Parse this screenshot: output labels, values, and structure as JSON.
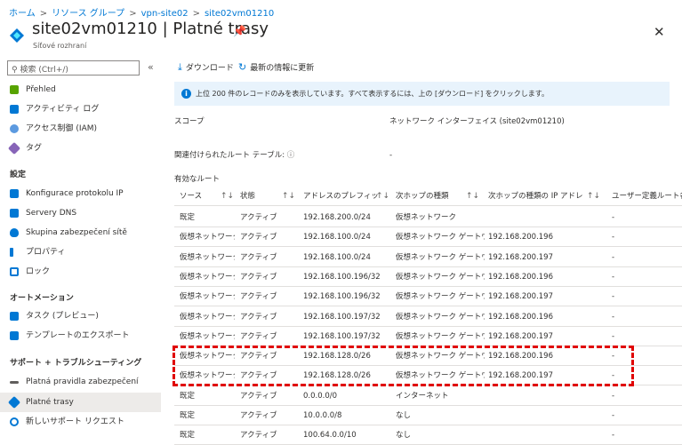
{
  "breadcrumb": [
    "ホーム",
    "リソース グループ",
    "vpn-site02",
    "site02vm01210"
  ],
  "title": "site02vm01210 | Platné trasy",
  "subtitle": "Síťové rozhraní",
  "icons": {
    "pin": "pin-icon",
    "close": "close-icon",
    "download": "download-icon",
    "refresh": "refresh-icon",
    "info": "info-icon"
  },
  "search": {
    "placeholder": "検索 (Ctrl+/)"
  },
  "sidebar": {
    "top": [
      "Přehled",
      "アクティビティ ログ",
      "アクセス制御 (IAM)",
      "タグ"
    ],
    "section1": "設定",
    "settings": [
      "Konfigurace protokolu IP",
      "Servery DNS",
      "Skupina zabezpečení sítě",
      "プロパティ",
      "ロック"
    ],
    "section2": "オートメーション",
    "automation": [
      "タスク (プレビュー)",
      "テンプレートのエクスポート"
    ],
    "section3": "サポート + トラブルシューティング",
    "support": [
      "Platná pravidla zabezpečení",
      "Platné trasy",
      "新しいサポート リクエスト"
    ],
    "selected": "Platné trasy"
  },
  "toolbar": {
    "download": "ダウンロード",
    "refresh": "最新の情報に更新"
  },
  "info": {
    "text": "上位 200 件のレコードのみを表示しています。すべて表示するには、上の [ダウンロード] をクリックします。"
  },
  "scope": {
    "label": "スコープ",
    "value": "ネットワーク インターフェイス (site02vm01210)"
  },
  "route_tables": {
    "label": "関連付けられたルート テーブル:",
    "value": "-"
  },
  "effective_routes_label": "有効なルート",
  "table": {
    "headers": [
      "ソース",
      "状態",
      "アドレスのプレフィック...",
      "次ホップの種類",
      "次ホップの種類の IP アドレス",
      "ユーザー定義ルート名"
    ],
    "rows": [
      [
        "既定",
        "アクティブ",
        "192.168.200.0/24",
        "仮想ネットワーク",
        "",
        "-"
      ],
      [
        "仮想ネットワーク...",
        "アクティブ",
        "192.168.100.0/24",
        "仮想ネットワーク ゲートウ...",
        "192.168.200.196",
        "-"
      ],
      [
        "仮想ネットワーク...",
        "アクティブ",
        "192.168.100.0/24",
        "仮想ネットワーク ゲートウ...",
        "192.168.200.197",
        "-"
      ],
      [
        "仮想ネットワーク...",
        "アクティブ",
        "192.168.100.196/32",
        "仮想ネットワーク ゲートウ...",
        "192.168.200.196",
        "-"
      ],
      [
        "仮想ネットワーク...",
        "アクティブ",
        "192.168.100.196/32",
        "仮想ネットワーク ゲートウ...",
        "192.168.200.197",
        "-"
      ],
      [
        "仮想ネットワーク...",
        "アクティブ",
        "192.168.100.197/32",
        "仮想ネットワーク ゲートウ...",
        "192.168.200.196",
        "-"
      ],
      [
        "仮想ネットワーク...",
        "アクティブ",
        "192.168.100.197/32",
        "仮想ネットワーク ゲートウ...",
        "192.168.200.197",
        "-"
      ],
      [
        "仮想ネットワーク...",
        "アクティブ",
        "192.168.128.0/26",
        "仮想ネットワーク ゲートウ...",
        "192.168.200.196",
        "-"
      ],
      [
        "仮想ネットワーク...",
        "アクティブ",
        "192.168.128.0/26",
        "仮想ネットワーク ゲートウ...",
        "192.168.200.197",
        "-"
      ],
      [
        "既定",
        "アクティブ",
        "0.0.0.0/0",
        "インターネット",
        "",
        "-"
      ],
      [
        "既定",
        "アクティブ",
        "10.0.0.0/8",
        "なし",
        "",
        "-"
      ],
      [
        "既定",
        "アクティブ",
        "100.64.0.0/10",
        "なし",
        "",
        "-"
      ]
    ]
  }
}
